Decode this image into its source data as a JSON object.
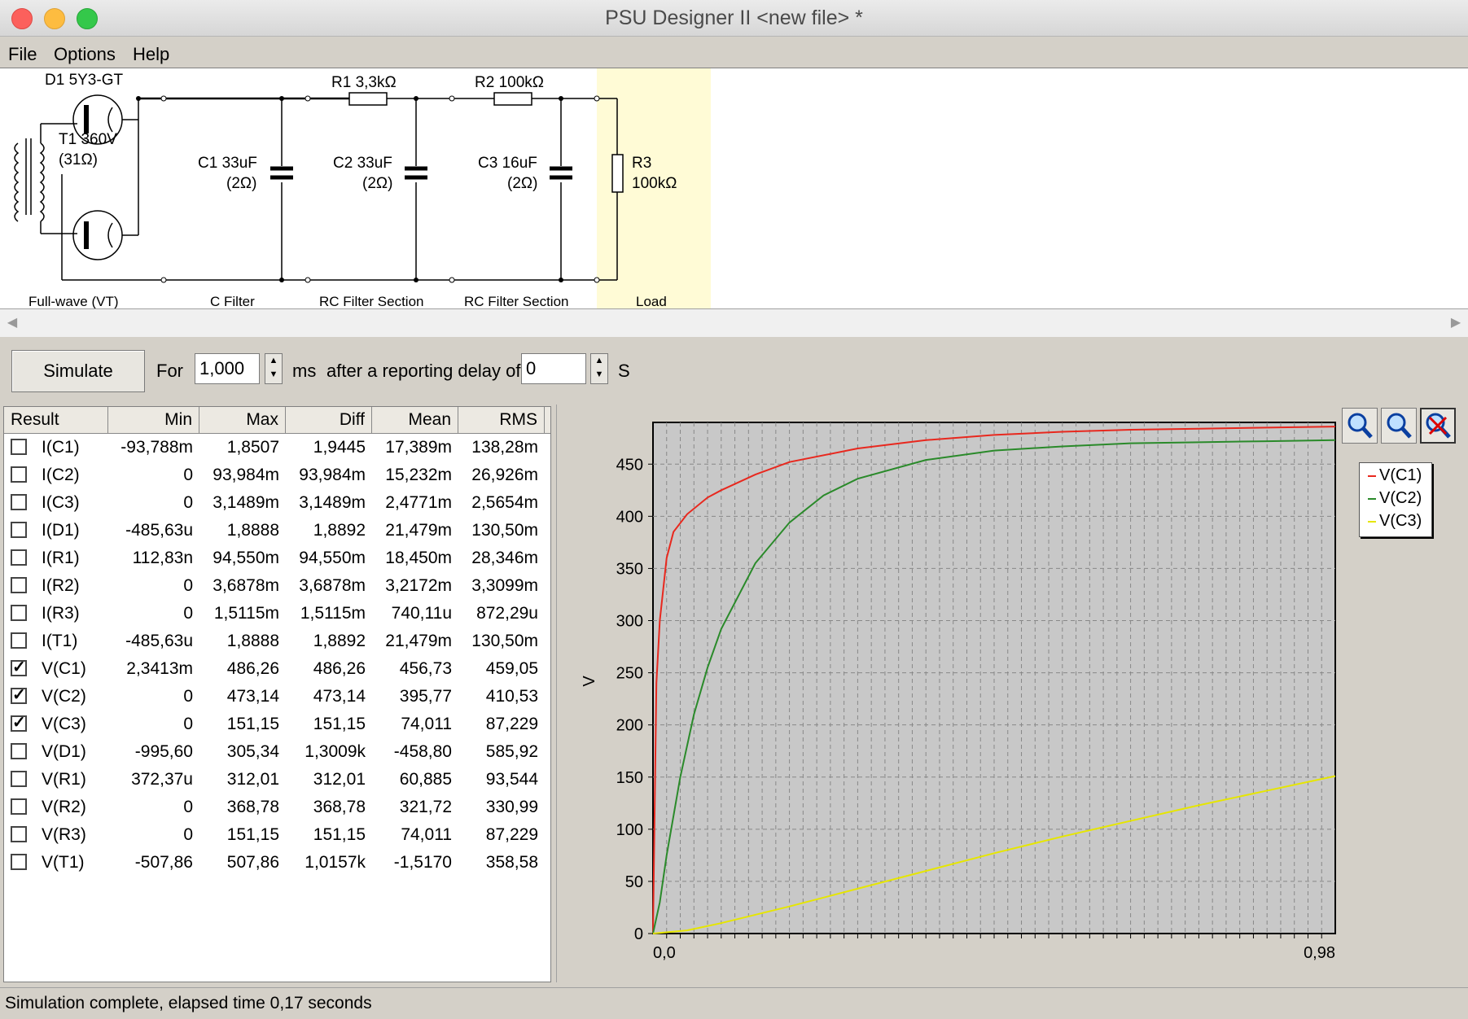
{
  "window": {
    "title": "PSU Designer II  <new file> *"
  },
  "menu": [
    "File",
    "Options",
    "Help"
  ],
  "schematic": {
    "d1_label": "D1 5Y3-GT",
    "t1_label": "T1 360V",
    "t1_res": "(31Ω)",
    "r1_label": "R1 3,3kΩ",
    "r2_label": "R2 100kΩ",
    "c1_label": "C1 33uF",
    "c1_res": "(2Ω)",
    "c2_label": "C2 33uF",
    "c2_res": "(2Ω)",
    "c3_label": "C3 16uF",
    "c3_res": "(2Ω)",
    "r3_label": "R3",
    "r3_value": "100kΩ",
    "sections": [
      "Full-wave (VT)",
      "C Filter",
      "RC Filter Section",
      "RC Filter Section",
      "Load"
    ]
  },
  "controls": {
    "simulate": "Simulate",
    "for_label": "For",
    "duration": "1,000",
    "ms_label": "ms",
    "delay_label": "after a reporting delay of",
    "delay": "0",
    "s_label": "S"
  },
  "results": {
    "columns": [
      "Result",
      "Min",
      "Max",
      "Diff",
      "Mean",
      "RMS"
    ],
    "rows": [
      {
        "checked": false,
        "cells": [
          "I(C1)",
          "-93,788m",
          "1,8507",
          "1,9445",
          "17,389m",
          "138,28m"
        ]
      },
      {
        "checked": false,
        "cells": [
          "I(C2)",
          "0",
          "93,984m",
          "93,984m",
          "15,232m",
          "26,926m"
        ]
      },
      {
        "checked": false,
        "cells": [
          "I(C3)",
          "0",
          "3,1489m",
          "3,1489m",
          "2,4771m",
          "2,5654m"
        ]
      },
      {
        "checked": false,
        "cells": [
          "I(D1)",
          "-485,63u",
          "1,8888",
          "1,8892",
          "21,479m",
          "130,50m"
        ]
      },
      {
        "checked": false,
        "cells": [
          "I(R1)",
          "112,83n",
          "94,550m",
          "94,550m",
          "18,450m",
          "28,346m"
        ]
      },
      {
        "checked": false,
        "cells": [
          "I(R2)",
          "0",
          "3,6878m",
          "3,6878m",
          "3,2172m",
          "3,3099m"
        ]
      },
      {
        "checked": false,
        "cells": [
          "I(R3)",
          "0",
          "1,5115m",
          "1,5115m",
          "740,11u",
          "872,29u"
        ]
      },
      {
        "checked": false,
        "cells": [
          "I(T1)",
          "-485,63u",
          "1,8888",
          "1,8892",
          "21,479m",
          "130,50m"
        ]
      },
      {
        "checked": true,
        "cells": [
          "V(C1)",
          "2,3413m",
          "486,26",
          "486,26",
          "456,73",
          "459,05"
        ]
      },
      {
        "checked": true,
        "cells": [
          "V(C2)",
          "0",
          "473,14",
          "473,14",
          "395,77",
          "410,53"
        ]
      },
      {
        "checked": true,
        "cells": [
          "V(C3)",
          "0",
          "151,15",
          "151,15",
          "74,011",
          "87,229"
        ]
      },
      {
        "checked": false,
        "cells": [
          "V(D1)",
          "-995,60",
          "305,34",
          "1,3009k",
          "-458,80",
          "585,92"
        ]
      },
      {
        "checked": false,
        "cells": [
          "V(R1)",
          "372,37u",
          "312,01",
          "312,01",
          "60,885",
          "93,544"
        ]
      },
      {
        "checked": false,
        "cells": [
          "V(R2)",
          "0",
          "368,78",
          "368,78",
          "321,72",
          "330,99"
        ]
      },
      {
        "checked": false,
        "cells": [
          "V(R3)",
          "0",
          "151,15",
          "151,15",
          "74,011",
          "87,229"
        ]
      },
      {
        "checked": false,
        "cells": [
          "V(T1)",
          "-507,86",
          "507,86",
          "1,0157k",
          "-1,5170",
          "358,58"
        ]
      }
    ]
  },
  "toolbar_icons": [
    "zoom-in-icon",
    "zoom-out-icon",
    "zoom-reset-icon"
  ],
  "chart_data": {
    "type": "line",
    "ylabel": "V",
    "xlabel": "",
    "ylim": [
      0,
      490
    ],
    "xlim": [
      0,
      1.0
    ],
    "y_ticks": [
      0,
      50,
      100,
      150,
      200,
      250,
      300,
      350,
      400,
      450
    ],
    "first_x_tick": "0,0",
    "last_x_tick": "0,98",
    "grid": true,
    "legend_position": "top-right",
    "series": [
      {
        "name": "V(C1)",
        "color": "#e8281e",
        "x": [
          0,
          0.005,
          0.01,
          0.02,
          0.03,
          0.05,
          0.08,
          0.1,
          0.15,
          0.2,
          0.3,
          0.4,
          0.5,
          0.6,
          0.7,
          0.8,
          0.9,
          1.0
        ],
        "y": [
          0,
          240,
          300,
          360,
          385,
          402,
          418,
          425,
          440,
          452,
          465,
          473,
          478,
          481,
          483,
          484,
          485,
          486
        ]
      },
      {
        "name": "V(C2)",
        "color": "#2a8a2a",
        "x": [
          0,
          0.01,
          0.02,
          0.04,
          0.06,
          0.08,
          0.1,
          0.15,
          0.2,
          0.25,
          0.3,
          0.4,
          0.5,
          0.6,
          0.7,
          0.8,
          0.9,
          1.0
        ],
        "y": [
          0,
          30,
          75,
          150,
          210,
          255,
          292,
          355,
          394,
          420,
          436,
          454,
          463,
          467,
          470,
          471,
          472,
          473
        ]
      },
      {
        "name": "V(C3)",
        "color": "#e6e600",
        "x": [
          0,
          0.05,
          0.1,
          0.2,
          0.3,
          0.4,
          0.5,
          0.6,
          0.7,
          0.8,
          0.9,
          1.0
        ],
        "y": [
          0,
          3,
          10,
          26,
          43,
          60,
          77,
          93,
          108,
          123,
          137,
          151
        ]
      }
    ]
  },
  "status": "Simulation complete, elapsed time 0,17 seconds"
}
